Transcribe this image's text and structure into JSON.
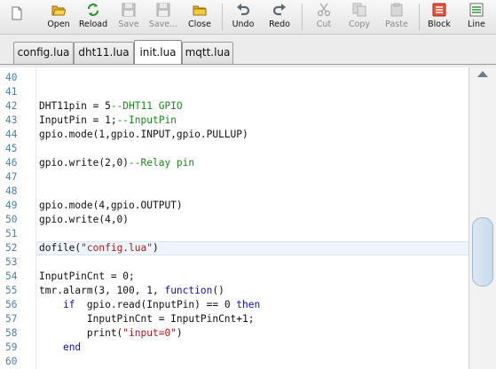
{
  "toolbar": {
    "buttons": [
      {
        "id": "new",
        "label": "",
        "icon": "new-file-icon"
      },
      {
        "id": "open",
        "label": "Open",
        "icon": "open-folder-icon"
      },
      {
        "id": "reload",
        "label": "Reload",
        "icon": "reload-icon"
      },
      {
        "id": "save",
        "label": "Save",
        "icon": "save-icon"
      },
      {
        "id": "saveas",
        "label": "Save...",
        "icon": "save-as-icon"
      },
      {
        "id": "close",
        "label": "Close",
        "icon": "close-file-icon"
      },
      {
        "id": "undo",
        "label": "Undo",
        "icon": "undo-icon"
      },
      {
        "id": "redo",
        "label": "Redo",
        "icon": "redo-icon"
      },
      {
        "id": "cut",
        "label": "Cut",
        "icon": "cut-icon"
      },
      {
        "id": "copy",
        "label": "Copy",
        "icon": "copy-icon"
      },
      {
        "id": "paste",
        "label": "Paste",
        "icon": "paste-icon"
      },
      {
        "id": "block",
        "label": "Block",
        "icon": "block-icon"
      },
      {
        "id": "line",
        "label": "Line",
        "icon": "line-icon"
      }
    ]
  },
  "tabs": [
    {
      "label": "config.lua",
      "active": false
    },
    {
      "label": "dht11.lua",
      "active": false
    },
    {
      "label": "init.lua",
      "active": true
    },
    {
      "label": "mqtt.lua",
      "active": false
    }
  ],
  "editor": {
    "current_line": "52",
    "lines": [
      {
        "n": "40",
        "text": ""
      },
      {
        "n": "41",
        "text": ""
      },
      {
        "n": "42",
        "text": "DHT11pin = 5--DHT11 GPIO"
      },
      {
        "n": "43",
        "text": "InputPin = 1;--InputPin"
      },
      {
        "n": "44",
        "text": "gpio.mode(1,gpio.INPUT,gpio.PULLUP)"
      },
      {
        "n": "45",
        "text": ""
      },
      {
        "n": "46",
        "text": "gpio.write(2,0)--Relay pin"
      },
      {
        "n": "47",
        "text": ""
      },
      {
        "n": "48",
        "text": ""
      },
      {
        "n": "49",
        "text": "gpio.mode(4,gpio.OUTPUT)"
      },
      {
        "n": "50",
        "text": "gpio.write(4,0)"
      },
      {
        "n": "51",
        "text": ""
      },
      {
        "n": "52",
        "text": "dofile(\"config.lua\")"
      },
      {
        "n": "53",
        "text": ""
      },
      {
        "n": "54",
        "text": "InputPinCnt = 0;"
      },
      {
        "n": "55",
        "text": "tmr.alarm(3, 100, 1, function()"
      },
      {
        "n": "56",
        "text": "    if  gpio.read(InputPin) == 0 then"
      },
      {
        "n": "57",
        "text": "        InputPinCnt = InputPinCnt+1;"
      },
      {
        "n": "58",
        "text": "        print(\"input=0\")"
      },
      {
        "n": "59",
        "text": "    end"
      },
      {
        "n": "60",
        "text": ""
      }
    ]
  }
}
